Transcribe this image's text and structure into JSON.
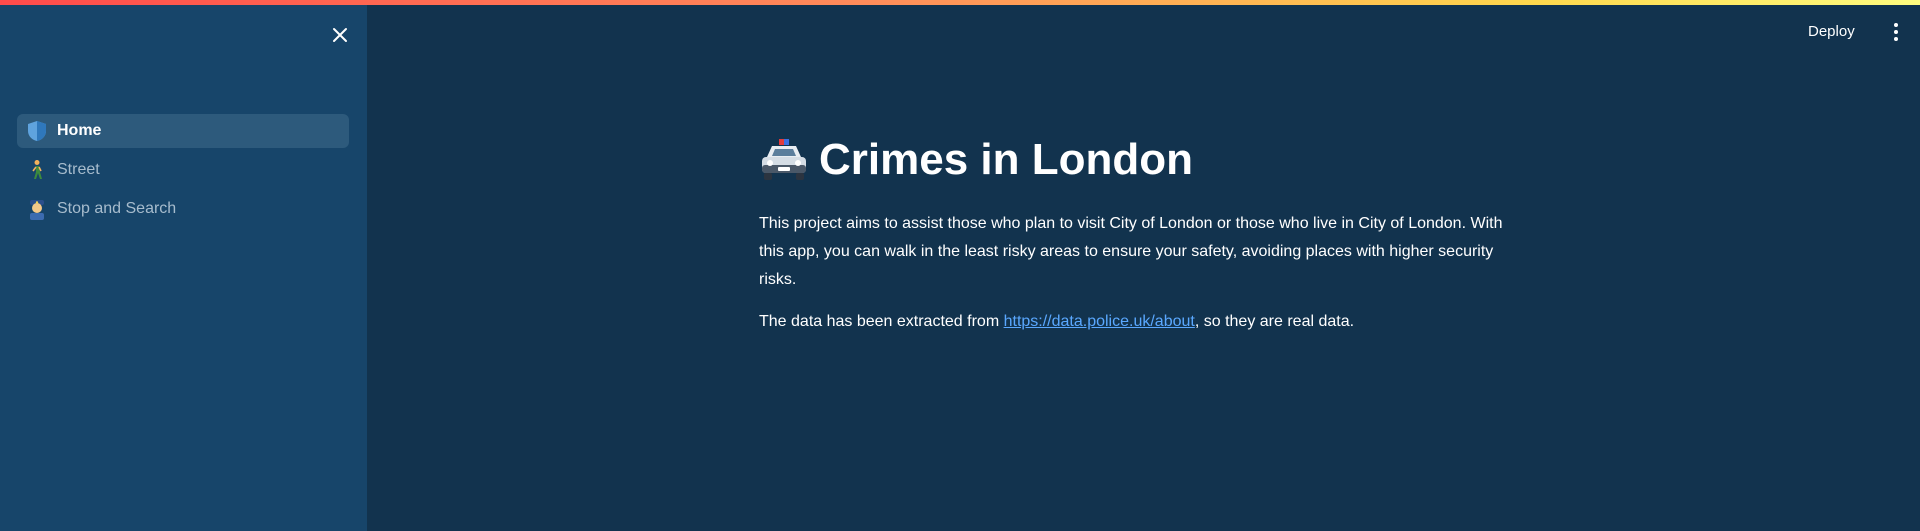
{
  "sidebar": {
    "close_icon": "close-icon",
    "items": [
      {
        "label": "Home",
        "icon": "shield-icon",
        "active": true
      },
      {
        "label": "Street",
        "icon": "walking-person-icon",
        "active": false
      },
      {
        "label": "Stop and Search",
        "icon": "police-officer-icon",
        "active": false
      }
    ]
  },
  "header": {
    "deploy_label": "Deploy",
    "menu_icon": "more-vertical-icon"
  },
  "main": {
    "title": "Crimes in London",
    "title_icon": "police-car-icon",
    "paragraph1": "This project aims to assist those who plan to visit City of London or those who live in City of London. With this app, you can walk in the least risky areas to ensure your safety, avoiding places with higher security risks.",
    "paragraph2_prefix": "The data has been extracted from ",
    "paragraph2_link": "https://data.police.uk/about",
    "paragraph2_suffix": ", so they are real data."
  },
  "colors": {
    "sidebar_bg": "#17456a",
    "main_bg": "#12334e",
    "active_item_bg": "#2d5a7c",
    "link": "#5aa8ff"
  }
}
